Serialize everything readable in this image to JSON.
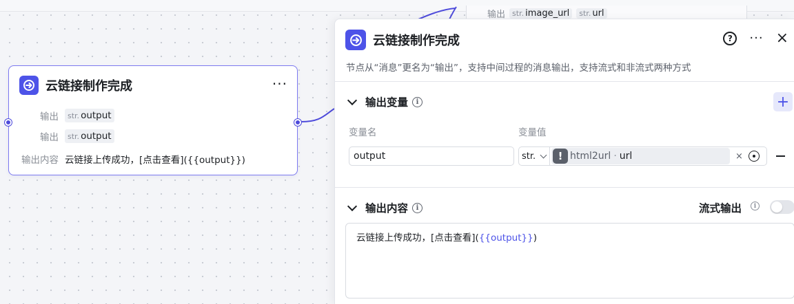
{
  "ghost_node": {
    "label": "输出",
    "tags": [
      {
        "type": "str.",
        "name": "image_url"
      },
      {
        "type": "str.",
        "name": "url"
      }
    ]
  },
  "node": {
    "title": "云链接制作完成",
    "more": "···",
    "rows": [
      {
        "label": "输出",
        "type": "str.",
        "name": "output"
      },
      {
        "label": "输出",
        "type": "str.",
        "name": "output"
      }
    ],
    "content_label": "输出内容",
    "content_value": "云链接上传成功，[点击查看]({{output}})"
  },
  "panel": {
    "title": "云链接制作完成",
    "help": "?",
    "more": "···",
    "close": "×",
    "description": "节点从“消息”更名为“输出”，支持中间过程的消息输出，支持流式和非流式两种方式",
    "output_vars": {
      "title": "输出变量",
      "add": "+",
      "col_name": "变量名",
      "col_value": "变量值",
      "row": {
        "name": "output",
        "type": "str.",
        "source": "html2url",
        "separator": "·",
        "field": "url",
        "warn": "!",
        "clear": "×"
      }
    },
    "output_content": {
      "title": "输出内容",
      "stream_label": "流式输出",
      "stream_enabled": false,
      "text_before": "云链接上传成功，[点击查看](",
      "text_var": "{{output}}",
      "text_after": ")"
    }
  },
  "colors": {
    "accent": "#4d53e8",
    "node_border": "#7b78f0"
  }
}
